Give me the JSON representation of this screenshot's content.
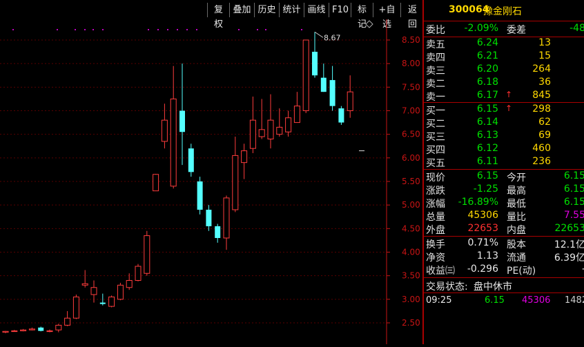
{
  "toolbar": [
    "复权",
    "叠加",
    "历史",
    "统计",
    "画线",
    "F10",
    "标记",
    "+自选",
    "返回"
  ],
  "stock": {
    "code": "300064",
    "name": "豫金刚石"
  },
  "weibi": {
    "label": "委比",
    "value": "-2.09%",
    "label2": "委差",
    "value2": "-48"
  },
  "sell": [
    {
      "label": "卖五",
      "price": "6.24",
      "vol": "13",
      "up": false
    },
    {
      "label": "卖四",
      "price": "6.21",
      "vol": "15",
      "up": false
    },
    {
      "label": "卖三",
      "price": "6.20",
      "vol": "264",
      "up": false
    },
    {
      "label": "卖二",
      "price": "6.18",
      "vol": "36",
      "up": false
    },
    {
      "label": "卖一",
      "price": "6.17",
      "vol": "845",
      "up": true
    }
  ],
  "buy": [
    {
      "label": "买一",
      "price": "6.15",
      "vol": "298",
      "up": true
    },
    {
      "label": "买二",
      "price": "6.14",
      "vol": "62",
      "up": false
    },
    {
      "label": "买三",
      "price": "6.13",
      "vol": "69",
      "up": false
    },
    {
      "label": "买四",
      "price": "6.12",
      "vol": "460",
      "up": false
    },
    {
      "label": "买五",
      "price": "6.11",
      "vol": "236",
      "up": false
    }
  ],
  "stats": [
    {
      "l1": "现价",
      "v1": "6.15",
      "c1": "g",
      "l2": "今开",
      "v2": "6.15",
      "c2": "g"
    },
    {
      "l1": "涨跌",
      "v1": "-1.25",
      "c1": "g",
      "l2": "最高",
      "v2": "6.15",
      "c2": "g"
    },
    {
      "l1": "涨幅",
      "v1": "-16.89%",
      "c1": "g",
      "l2": "最低",
      "v2": "6.15",
      "c2": "g"
    },
    {
      "l1": "总量",
      "v1": "45306",
      "c1": "y",
      "l2": "量比",
      "v2": "7.55",
      "c2": "m"
    },
    {
      "l1": "外盘",
      "v1": "22653",
      "c1": "r",
      "l2": "内盘",
      "v2": "22653",
      "c2": "g"
    }
  ],
  "stats2": [
    {
      "l1": "换手",
      "v1": "0.71%",
      "l2": "股本",
      "v2": "12.1亿"
    },
    {
      "l1": "净资",
      "v1": "1.13",
      "l2": "流通",
      "v2": "6.39亿"
    },
    {
      "l1": "收益㈢",
      "v1": "-0.296",
      "l2": "PE(动)",
      "v2": "-"
    }
  ],
  "status": {
    "label": "交易状态:",
    "value": "盘中休市"
  },
  "tick": {
    "time": "09:25",
    "price": "6.15",
    "vol": "45306",
    "extra": "1482"
  },
  "chart_data": {
    "type": "candlestick",
    "yticks": [
      "8.50",
      "8.00",
      "7.50",
      "7.00",
      "6.50",
      "6.00",
      "5.50",
      "5.00",
      "4.50",
      "4.00",
      "3.50",
      "3.00",
      "2.50"
    ],
    "high_annotation": "8.67",
    "candles": [
      {
        "o": 2.3,
        "c": 2.32,
        "h": 2.33,
        "l": 2.28
      },
      {
        "o": 2.32,
        "c": 2.33,
        "h": 2.35,
        "l": 2.31
      },
      {
        "o": 2.33,
        "c": 2.35,
        "h": 2.37,
        "l": 2.32
      },
      {
        "o": 2.35,
        "c": 2.37,
        "h": 2.4,
        "l": 2.34
      },
      {
        "o": 2.4,
        "c": 2.33,
        "h": 2.42,
        "l": 2.32
      },
      {
        "o": 2.32,
        "c": 2.33,
        "h": 2.36,
        "l": 2.3
      },
      {
        "o": 2.35,
        "c": 2.45,
        "h": 2.48,
        "l": 2.3
      },
      {
        "o": 2.45,
        "c": 2.6,
        "h": 2.75,
        "l": 2.43
      },
      {
        "o": 2.6,
        "c": 3.05,
        "h": 3.1,
        "l": 2.58
      },
      {
        "o": 3.3,
        "c": 3.33,
        "h": 3.62,
        "l": 3.25
      },
      {
        "o": 3.1,
        "c": 3.25,
        "h": 3.4,
        "l": 2.93
      },
      {
        "o": 2.93,
        "c": 2.9,
        "h": 3.12,
        "l": 2.87
      },
      {
        "o": 2.85,
        "c": 3.05,
        "h": 3.08,
        "l": 2.83
      },
      {
        "o": 3.0,
        "c": 3.3,
        "h": 3.35,
        "l": 2.98
      },
      {
        "o": 3.25,
        "c": 3.4,
        "h": 3.55,
        "l": 3.2
      },
      {
        "o": 3.4,
        "c": 3.7,
        "h": 3.75,
        "l": 3.38
      },
      {
        "o": 3.55,
        "c": 4.35,
        "h": 4.45,
        "l": 3.5
      },
      {
        "o": 5.3,
        "c": 5.65,
        "h": 5.66,
        "l": 5.3
      },
      {
        "o": 6.35,
        "c": 6.8,
        "h": 7.15,
        "l": 6.2
      },
      {
        "o": 5.4,
        "c": 7.25,
        "h": 7.95,
        "l": 5.35
      },
      {
        "o": 7.0,
        "c": 6.55,
        "h": 8.0,
        "l": 5.85
      },
      {
        "o": 6.2,
        "c": 5.7,
        "h": 6.3,
        "l": 5.6
      },
      {
        "o": 5.5,
        "c": 4.9,
        "h": 5.6,
        "l": 4.8
      },
      {
        "o": 4.9,
        "c": 4.55,
        "h": 5.0,
        "l": 4.45
      },
      {
        "o": 4.55,
        "c": 4.3,
        "h": 4.6,
        "l": 4.2
      },
      {
        "o": 4.3,
        "c": 5.15,
        "h": 5.2,
        "l": 4.05
      },
      {
        "o": 4.9,
        "c": 6.05,
        "h": 6.45,
        "l": 4.85
      },
      {
        "o": 5.9,
        "c": 6.15,
        "h": 6.3,
        "l": 5.55
      },
      {
        "o": 6.2,
        "c": 6.8,
        "h": 7.3,
        "l": 6.1
      },
      {
        "o": 6.45,
        "c": 6.6,
        "h": 7.25,
        "l": 6.4
      },
      {
        "o": 6.4,
        "c": 6.8,
        "h": 7.35,
        "l": 6.2
      },
      {
        "o": 6.5,
        "c": 6.65,
        "h": 7.05,
        "l": 6.45
      },
      {
        "o": 6.55,
        "c": 6.85,
        "h": 7.0,
        "l": 6.45
      },
      {
        "o": 6.75,
        "c": 7.1,
        "h": 7.4,
        "l": 6.75
      },
      {
        "o": 7.0,
        "c": 8.5,
        "h": 8.5,
        "l": 6.95
      },
      {
        "o": 8.25,
        "c": 7.75,
        "h": 8.67,
        "l": 7.7
      },
      {
        "o": 7.7,
        "c": 7.4,
        "h": 8.0,
        "l": 7.4
      },
      {
        "o": 7.65,
        "c": 7.1,
        "h": 7.95,
        "l": 7.0
      },
      {
        "o": 7.05,
        "c": 6.75,
        "h": 7.1,
        "l": 6.7
      },
      {
        "o": 7.0,
        "c": 7.4,
        "h": 7.75,
        "l": 6.85
      }
    ],
    "last_price": 6.15
  }
}
